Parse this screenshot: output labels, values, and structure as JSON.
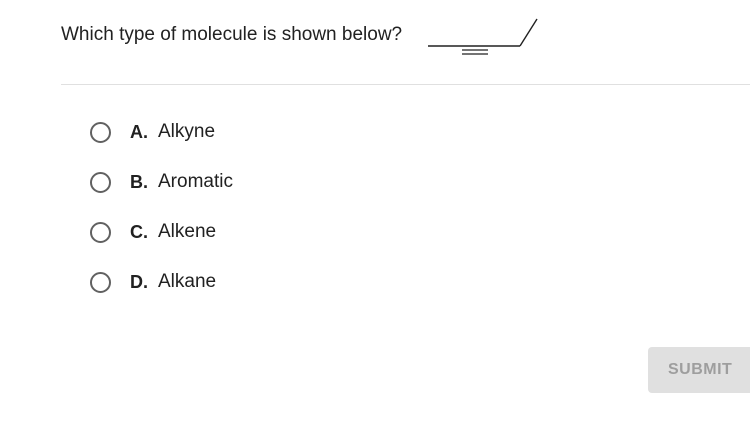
{
  "question": {
    "text": "Which type of molecule is shown below?",
    "molecule_icon": "skeletal-formula-alkyne"
  },
  "options": [
    {
      "letter": "A.",
      "label": "Alkyne"
    },
    {
      "letter": "B.",
      "label": "Aromatic"
    },
    {
      "letter": "C.",
      "label": "Alkene"
    },
    {
      "letter": "D.",
      "label": "Alkane"
    }
  ],
  "submit": {
    "label": "SUBMIT",
    "enabled": false
  },
  "colors": {
    "text": "#212121",
    "radio_border": "#616161",
    "divider": "#e0e0e0",
    "submit_bg": "#e0e0e0",
    "submit_text": "#9e9e9e"
  }
}
